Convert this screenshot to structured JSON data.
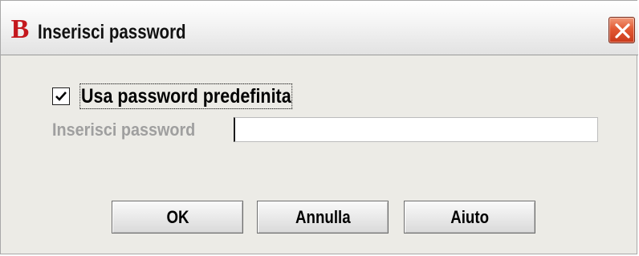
{
  "window": {
    "title": "Inserisci password",
    "app_icon_letter": "B",
    "icons": {
      "app": "app-logo-icon",
      "close": "close-icon",
      "check": "check-icon"
    },
    "colors": {
      "app_icon": "#c4181d",
      "close_button": "#e35a34",
      "background": "#ecebe6",
      "disabled_text": "#9f9f9f"
    }
  },
  "form": {
    "use_default_password": {
      "label": "Usa password predefinita",
      "checked": true
    },
    "password": {
      "label": "Inserisci password",
      "value": "",
      "enabled": false
    }
  },
  "buttons": {
    "ok": "OK",
    "cancel": "Annulla",
    "help": "Aiuto"
  }
}
